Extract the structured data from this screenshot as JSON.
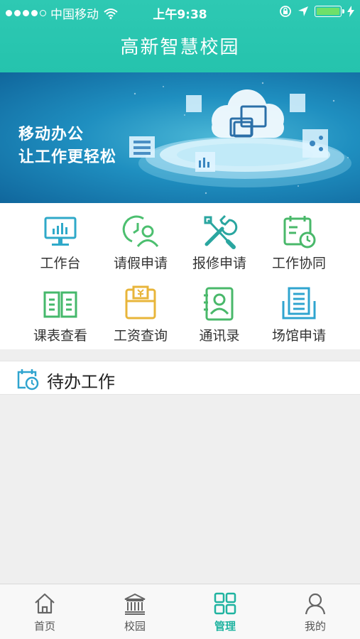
{
  "status_bar": {
    "carrier": "中国移动",
    "time": "上午9:38"
  },
  "header": {
    "title": "高新智慧校园"
  },
  "banner": {
    "line1": "移动办公",
    "line2": "让工作更轻松"
  },
  "features": [
    {
      "label": "工作台",
      "icon": "dashboard-monitor-icon",
      "color": "#2fa9c9"
    },
    {
      "label": "请假申请",
      "icon": "leave-clock-person-icon",
      "color": "#4cbf6f"
    },
    {
      "label": "报修申请",
      "icon": "repair-tools-icon",
      "color": "#2aa6a0"
    },
    {
      "label": "工作协同",
      "icon": "calendar-collab-icon",
      "color": "#49b86a"
    },
    {
      "label": "课表查看",
      "icon": "open-book-icon",
      "color": "#45b86b"
    },
    {
      "label": "工资查询",
      "icon": "salary-envelope-icon",
      "color": "#e8b53a"
    },
    {
      "label": "通讯录",
      "icon": "contacts-card-icon",
      "color": "#49b86a"
    },
    {
      "label": "场馆申请",
      "icon": "venue-document-icon",
      "color": "#2fa4cf"
    }
  ],
  "todo": {
    "label": "待办工作",
    "icon": "todo-calendar-clock-icon"
  },
  "tabbar": {
    "active": "管理",
    "items": [
      {
        "label": "首页",
        "icon": "home-icon"
      },
      {
        "label": "校园",
        "icon": "campus-building-icon"
      },
      {
        "label": "管理",
        "icon": "grid-manage-icon"
      },
      {
        "label": "我的",
        "icon": "user-profile-icon"
      }
    ]
  },
  "colors": {
    "header": "#27c4ae",
    "accent": "#1fb3a0",
    "background": "#efefef"
  }
}
